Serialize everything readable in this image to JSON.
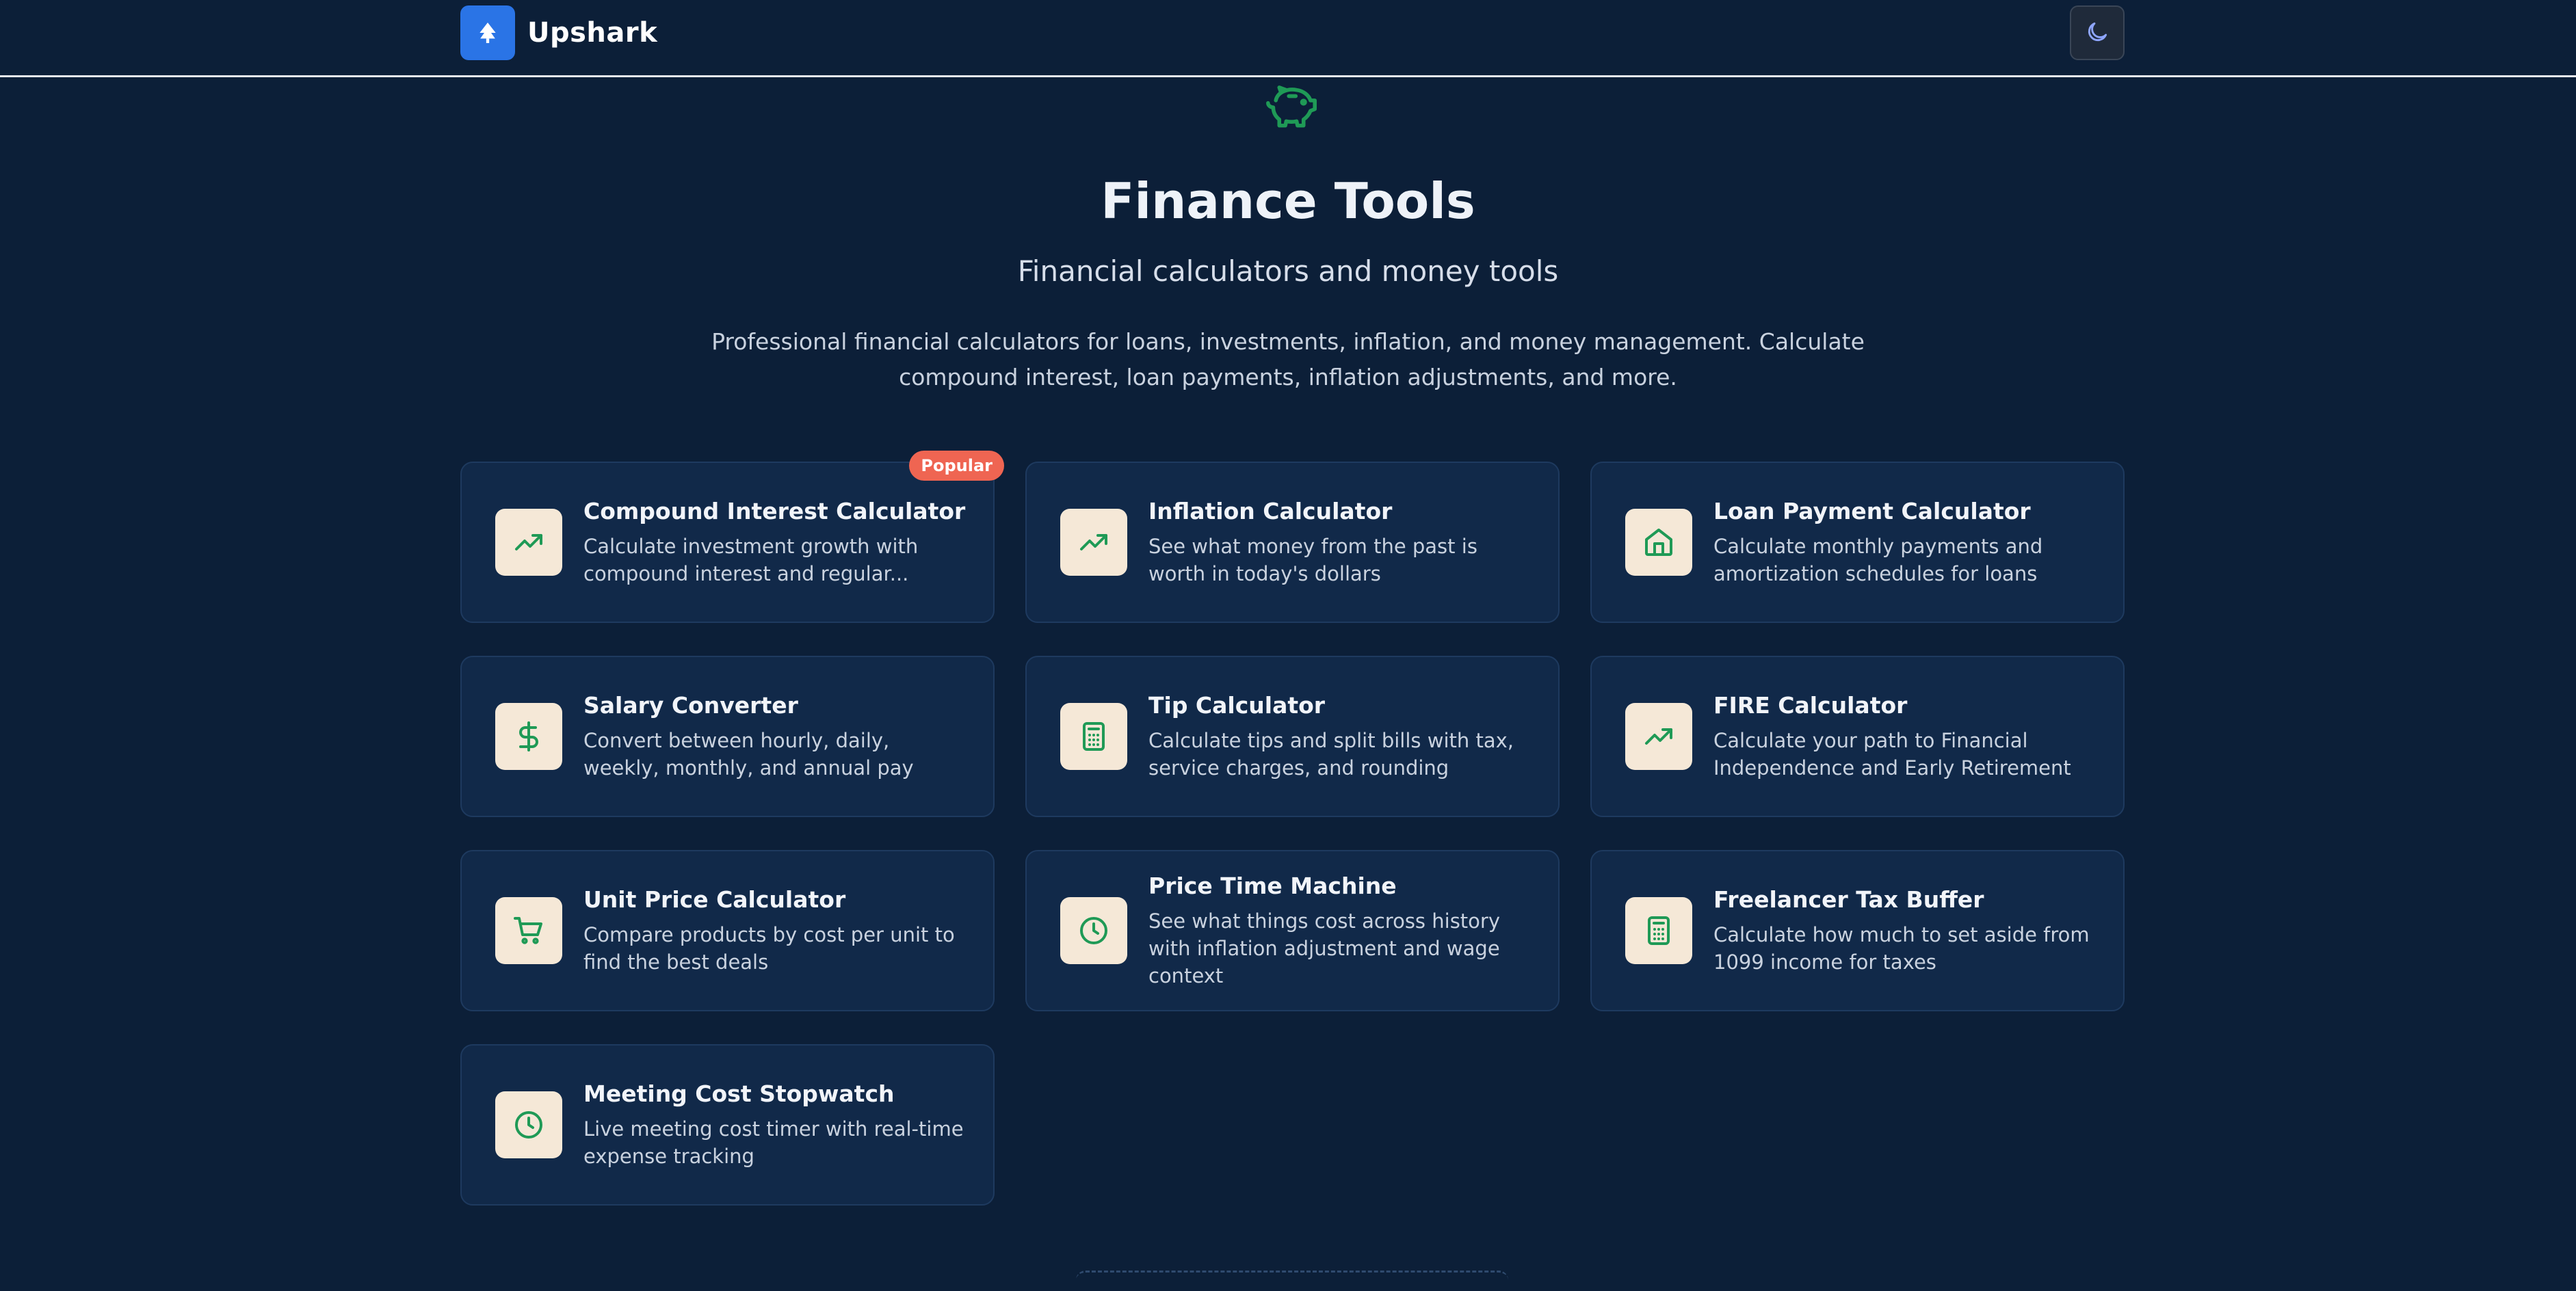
{
  "brand": {
    "name": "Upshark"
  },
  "hero": {
    "title": "Finance Tools",
    "subtitle": "Financial calculators and money tools",
    "description": "Professional financial calculators for loans, investments, inflation, and money management. Calculate compound interest, loan payments, inflation adjustments, and more."
  },
  "colors": {
    "background": "#0c1f38",
    "card_background": "#112949",
    "icon_tile": "#f5e8d7",
    "icon_green": "#1f9a56",
    "accent_blue": "#2a74e6",
    "badge_red": "#ef6552"
  },
  "tools": [
    {
      "title": "Compound Interest Calculator",
      "description": "Calculate investment growth with compound interest and regular...",
      "icon": "trending-up-icon",
      "badge": "Popular"
    },
    {
      "title": "Inflation Calculator",
      "description": "See what money from the past is worth in today's dollars",
      "icon": "trending-up-icon"
    },
    {
      "title": "Loan Payment Calculator",
      "description": "Calculate monthly payments and amortization schedules for loans",
      "icon": "home-icon"
    },
    {
      "title": "Salary Converter",
      "description": "Convert between hourly, daily, weekly, monthly, and annual pay",
      "icon": "dollar-icon"
    },
    {
      "title": "Tip Calculator",
      "description": "Calculate tips and split bills with tax, service charges, and rounding",
      "icon": "calculator-icon"
    },
    {
      "title": "FIRE Calculator",
      "description": "Calculate your path to Financial Independence and Early Retirement",
      "icon": "trending-up-icon"
    },
    {
      "title": "Unit Price Calculator",
      "description": "Compare products by cost per unit to find the best deals",
      "icon": "cart-icon"
    },
    {
      "title": "Price Time Machine",
      "description": "See what things cost across history with inflation adjustment and wage context",
      "icon": "clock-icon"
    },
    {
      "title": "Freelancer Tax Buffer",
      "description": "Calculate how much to set aside from 1099 income for taxes",
      "icon": "calculator-icon"
    },
    {
      "title": "Meeting Cost Stopwatch",
      "description": "Live meeting cost timer with real-time expense tracking",
      "icon": "clock-icon"
    }
  ]
}
